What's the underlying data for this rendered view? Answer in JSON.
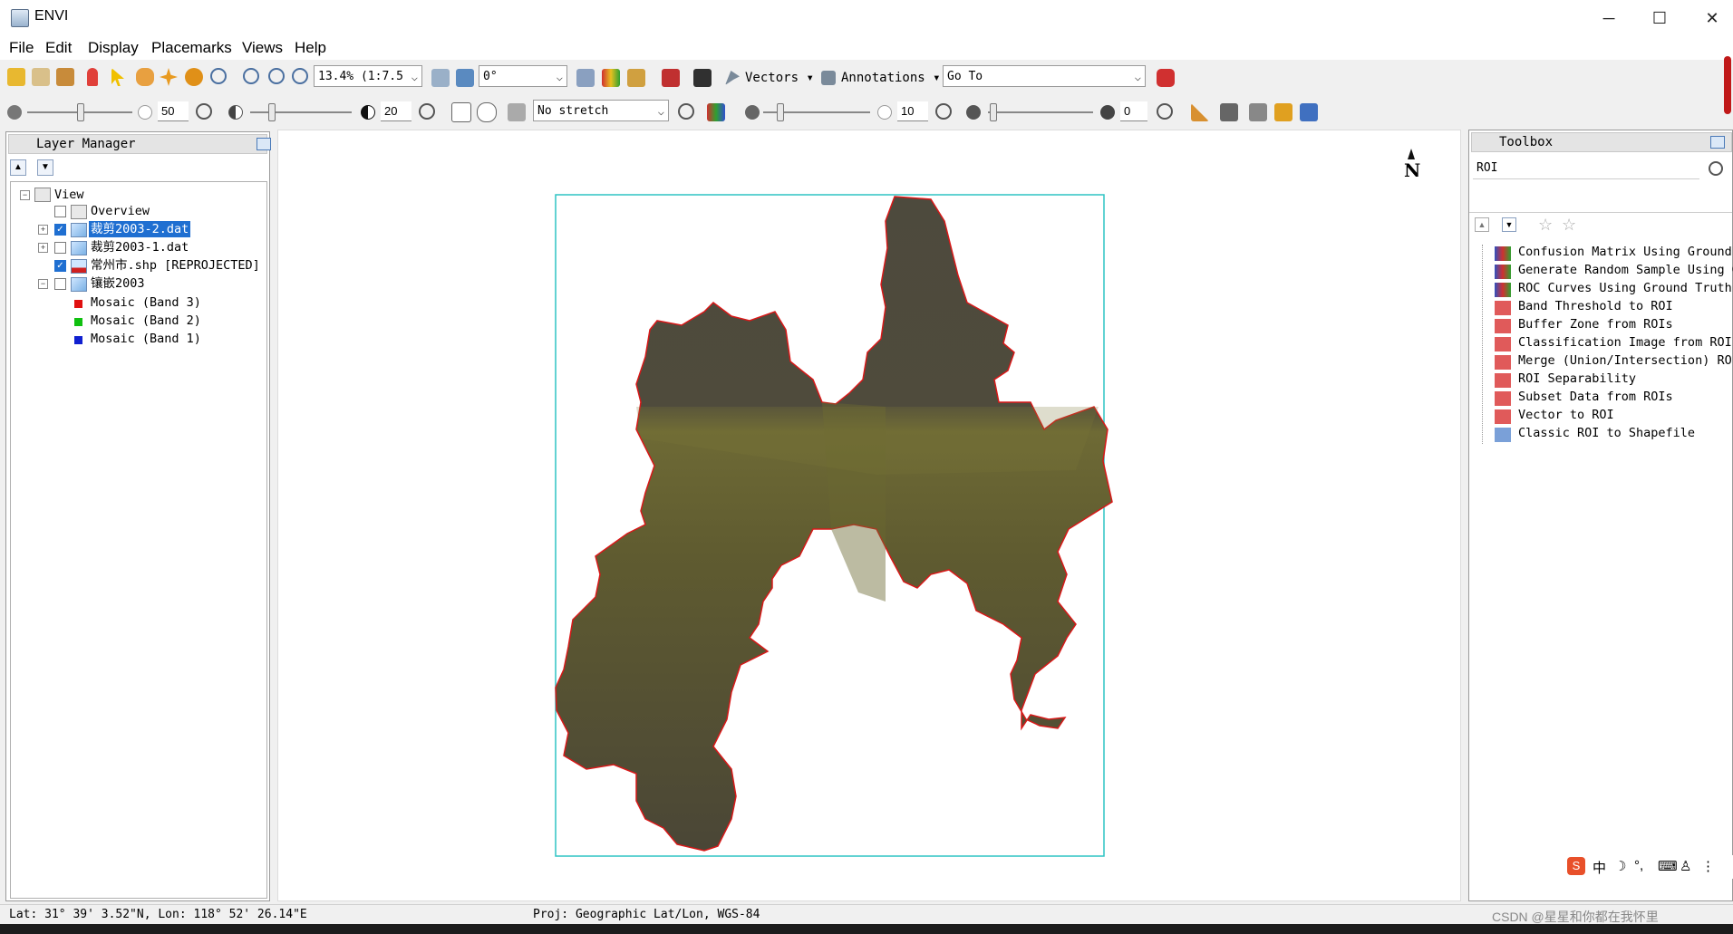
{
  "window": {
    "title": "ENVI",
    "minimize": "─",
    "maximize": "☐",
    "close": "✕"
  },
  "menu": [
    "File",
    "Edit",
    "Display",
    "Placemarks",
    "Views",
    "Help"
  ],
  "toolbar": {
    "zoom_value": "13.4% (1:7.5",
    "rotation_value": "0°",
    "vectors_label": "Vectors",
    "annotations_label": "Annotations",
    "goto_value": "Go To",
    "brightness_value": "50",
    "contrast_value": "20",
    "stretch_value": "No stretch",
    "sharpen_value": "10",
    "transparency_value": "0"
  },
  "layer_manager": {
    "title": "Layer Manager",
    "view_label": "View",
    "layers": [
      {
        "label": "Overview",
        "checked": false
      },
      {
        "label": "裁剪2003-2.dat",
        "checked": true,
        "selected": true
      },
      {
        "label": "裁剪2003-1.dat",
        "checked": false
      },
      {
        "label": "常州市.shp [REPROJECTED]",
        "checked": true
      },
      {
        "label": "镶嵌2003",
        "checked": false
      }
    ],
    "bands": [
      {
        "label": "Mosaic (Band 3)",
        "color": "#e01010"
      },
      {
        "label": "Mosaic (Band 2)",
        "color": "#10c010"
      },
      {
        "label": "Mosaic (Band 1)",
        "color": "#1020d0"
      }
    ]
  },
  "view": {
    "north_arrow": "N"
  },
  "toolbox": {
    "title": "Toolbox",
    "search_value": "ROI",
    "tools": [
      "Confusion Matrix Using Ground Tr",
      "Generate Random Sample Using Gr",
      "ROC Curves Using Ground Truth R",
      "Band Threshold to ROI",
      "Buffer Zone from ROIs",
      "Classification Image from ROIs",
      "Merge (Union/Intersection) ROIs",
      "ROI Separability",
      "Subset Data from ROIs",
      "Vector to ROI",
      "Classic ROI to Shapefile"
    ]
  },
  "status": {
    "latlon": "Lat: 31° 39' 3.52\"N, Lon: 118° 52' 26.14\"E",
    "proj": "Proj: Geographic Lat/Lon, WGS-84",
    "watermark": "CSDN @星星和你都在我怀里"
  },
  "colors": {
    "accent": "#1f6fd1",
    "map_frame": "#2ec4c4",
    "boundary": "#d81818",
    "imagery": "#5b5a2e"
  }
}
